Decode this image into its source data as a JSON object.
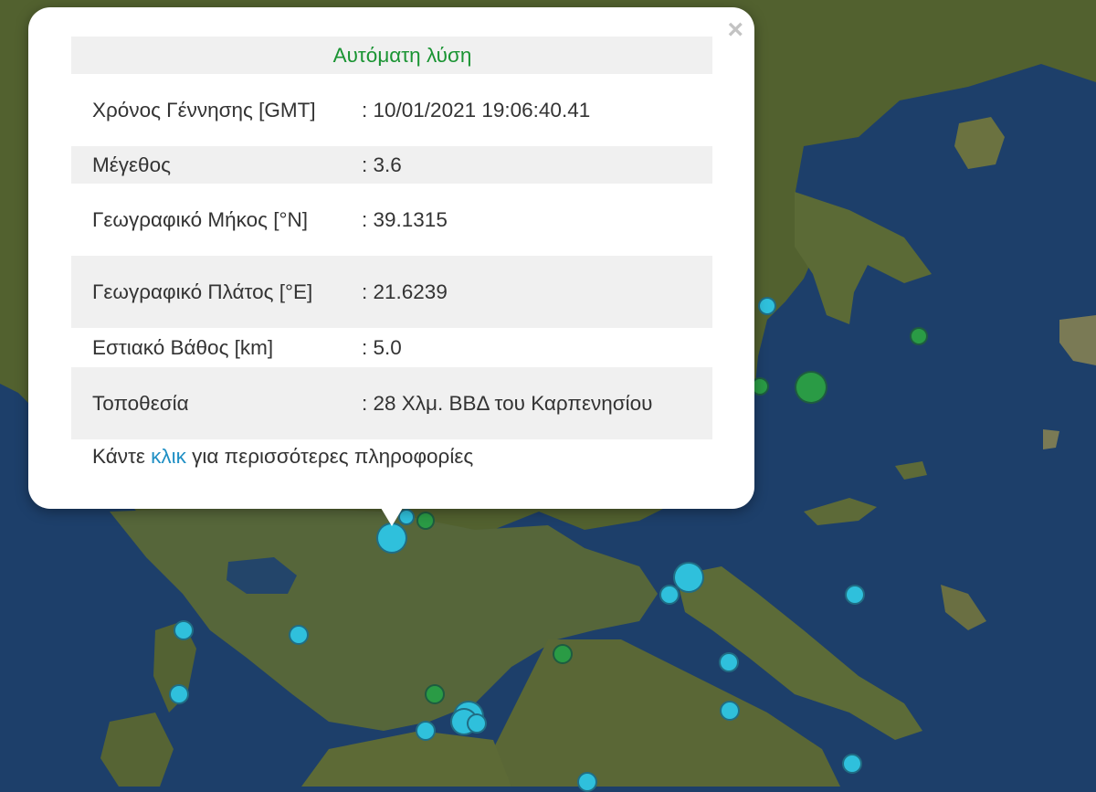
{
  "popup": {
    "title": "Αυτόματη λύση",
    "close_glyph": "×",
    "rows": [
      {
        "label": "Χρόνος Γέννησης [GMT]",
        "value": ": 10/01/2021 19:06:40.41"
      },
      {
        "label": "Μέγεθος",
        "value": ": 3.6"
      },
      {
        "label": "Γεωγραφικό Μήκος [°N]",
        "value": ": 39.1315"
      },
      {
        "label": "Γεωγραφικό Πλάτος [°E]",
        "value": ": 21.6239"
      },
      {
        "label": "Εστιακό Βάθος [km]",
        "value": ": 5.0"
      },
      {
        "label": "Τοποθεσία",
        "value": ": 28 Χλμ. ΒΒΔ του Καρπενησίου"
      }
    ],
    "footer_prefix": "Κάντε ",
    "footer_link": "κλικ",
    "footer_suffix": " για περισσότερες πληροφορίες"
  },
  "map": {
    "sea_color": "#1d3f6a",
    "marker_colors": {
      "recent": "#2fc0dc",
      "older": "#2a9b45"
    }
  }
}
